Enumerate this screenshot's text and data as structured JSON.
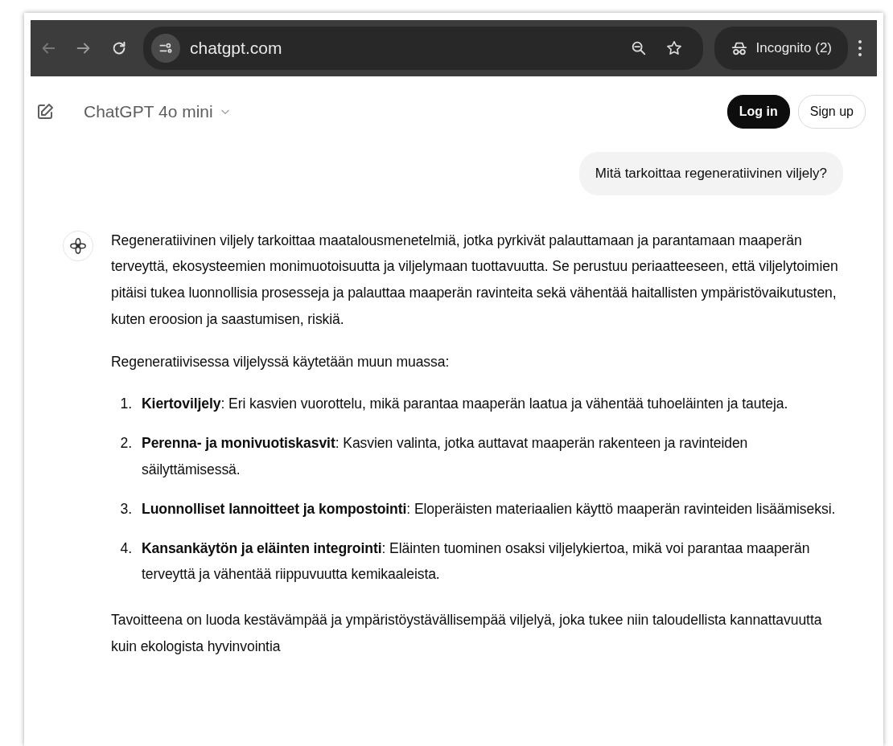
{
  "browser": {
    "address": "chatgpt.com",
    "profile": "Incognito (2)"
  },
  "header": {
    "model": "ChatGPT 4o mini",
    "buttons": [
      {
        "label": "Log in",
        "kind": "primary"
      },
      {
        "label": "Sign up",
        "kind": "outline"
      }
    ]
  },
  "messages": [
    {
      "kind": "user",
      "text": "Mitä tarkoittaa regeneratiivinen viljely?"
    },
    {
      "kind": "assistant",
      "blocks": [
        {
          "kind": "paragraph",
          "text": "Regeneratiivinen viljely tarkoittaa maatalousmenetelmiä, jotka pyrkivät palauttamaan ja parantamaan maaperän terveyttä, ekosysteemien monimuotoisuutta ja viljelymaan tuottavuutta. Se perustuu periaatteeseen, että viljelytoimien pitäisi tukea luonnollisia prosesseja ja palauttaa maaperän ravinteita sekä vähentää haitallisten ympäristövaikutusten, kuten eroosion ja saastumisen, riskiä."
        },
        {
          "kind": "paragraph",
          "text": "Regeneratiivisessa viljelyssä käytetään muun muassa:"
        },
        {
          "kind": "list",
          "items": [
            {
              "number": "1.",
              "text": "**Kiertoviljely**: Eri kasvien vuorottelu, mikä parantaa maaperän laatua ja vähentää tuhoeläinten ja tauteja."
            },
            {
              "number": "2.",
              "text": "**Perenna- ja monivuotiskasvit**: Kasvien valinta, jotka auttavat maaperän rakenteen ja ravinteiden säilyttämisessä."
            },
            {
              "number": "3.",
              "text": "**Luonnolliset lannoitteet ja kompostointi**: Eloperäisten materiaalien käyttö maaperän ravinteiden lisäämiseksi."
            },
            {
              "number": "4.",
              "text": "**Kansankäytön ja eläinten integrointi**: Eläinten tuominen osaksi viljelykiertoa, mikä voi parantaa maaperän terveyttä ja vähentää riippuvuutta kemikaaleista."
            }
          ]
        },
        {
          "kind": "paragraph",
          "text": "Tavoitteena on luoda kestävämpää ja ympäristöystävällisempää viljelyä, joka tukee niin taloudellista kannattavuutta kuin ekologista hyvinvointia"
        }
      ]
    }
  ]
}
